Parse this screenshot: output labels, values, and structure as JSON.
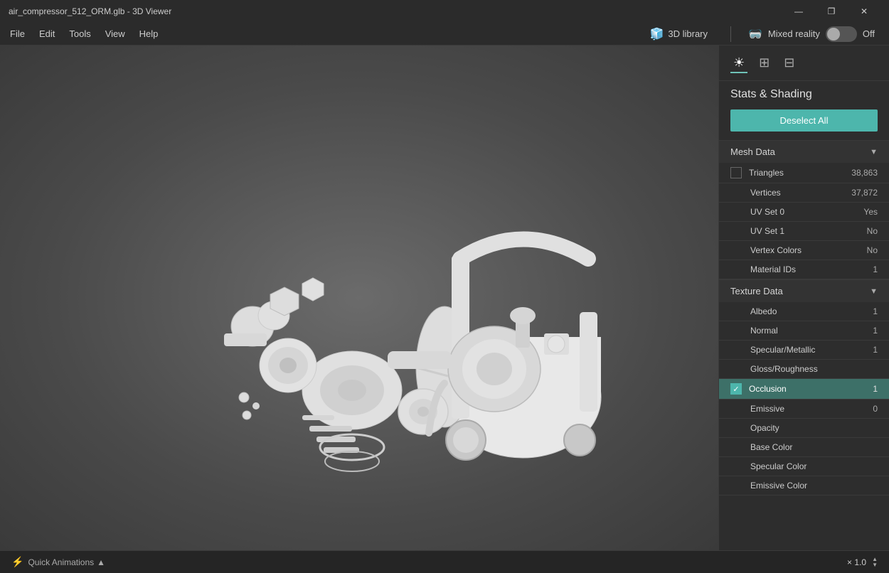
{
  "titlebar": {
    "title": "air_compressor_512_ORM.glb - 3D Viewer",
    "min_btn": "—",
    "restore_btn": "❐",
    "close_btn": "✕"
  },
  "menubar": {
    "items": [
      "File",
      "Edit",
      "Tools",
      "View",
      "Help"
    ],
    "library_btn": "3D library",
    "mixed_reality_label": "Mixed reality",
    "mixed_reality_state": "Off"
  },
  "panel": {
    "section_title": "Stats & Shading",
    "deselect_btn": "Deselect All",
    "mesh_data_header": "Mesh Data",
    "texture_data_header": "Texture Data",
    "mesh_rows": [
      {
        "label": "Triangles",
        "value": "38,863",
        "has_checkbox": true,
        "checked": false
      },
      {
        "label": "Vertices",
        "value": "37,872",
        "has_checkbox": false
      },
      {
        "label": "UV Set 0",
        "value": "Yes",
        "has_checkbox": false
      },
      {
        "label": "UV Set 1",
        "value": "No",
        "has_checkbox": false
      },
      {
        "label": "Vertex Colors",
        "value": "No",
        "has_checkbox": false
      },
      {
        "label": "Material IDs",
        "value": "1",
        "has_checkbox": false
      }
    ],
    "texture_rows": [
      {
        "label": "Albedo",
        "value": "1",
        "has_checkbox": false,
        "highlighted": false
      },
      {
        "label": "Normal",
        "value": "1",
        "has_checkbox": false,
        "highlighted": false
      },
      {
        "label": "Specular/Metallic",
        "value": "1",
        "has_checkbox": false,
        "highlighted": false
      },
      {
        "label": "Gloss/Roughness",
        "value": "",
        "has_checkbox": false,
        "highlighted": false
      },
      {
        "label": "Occlusion",
        "value": "1",
        "has_checkbox": true,
        "checked": true,
        "highlighted": true
      },
      {
        "label": "Emissive",
        "value": "0",
        "has_checkbox": false,
        "highlighted": false
      },
      {
        "label": "Opacity",
        "value": "",
        "has_checkbox": false,
        "highlighted": false
      },
      {
        "label": "Base Color",
        "value": "",
        "has_checkbox": false,
        "highlighted": false
      },
      {
        "label": "Specular Color",
        "value": "",
        "has_checkbox": false,
        "highlighted": false
      },
      {
        "label": "Emissive Color",
        "value": "",
        "has_checkbox": false,
        "highlighted": false
      }
    ]
  },
  "bottom_bar": {
    "animations_label": "Quick Animations",
    "zoom_label": "× 1.0"
  }
}
